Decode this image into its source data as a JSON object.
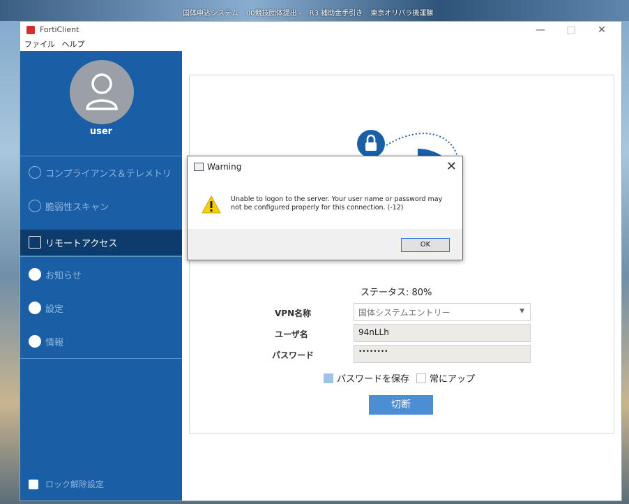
{
  "desktop": {
    "labels": [
      "国体申込システム",
      "00競技団体提出 -",
      "R3 補助金手引き",
      "東京オリパラ機運醸"
    ]
  },
  "window": {
    "title": "FortiClient",
    "menu": [
      "ファイル",
      "ヘルプ"
    ]
  },
  "sidebar": {
    "username": "user",
    "items": [
      {
        "label": "コンプライアンス＆テレメトリ",
        "icon": "gauge-icon"
      },
      {
        "label": "脆弱性スキャン",
        "icon": "vulnerability-icon"
      },
      {
        "label": "リモートアクセス",
        "icon": "remote-access-icon"
      },
      {
        "label": "お知らせ",
        "icon": "notification-icon"
      },
      {
        "label": "設定",
        "icon": "gear-icon"
      },
      {
        "label": "情報",
        "icon": "info-icon"
      }
    ],
    "lock_label": "ロック解除設定"
  },
  "vpn": {
    "status": "ステータス: 80%",
    "name_label": "VPN名称",
    "name_value": "国体システムエントリー",
    "user_label": "ユーザ名",
    "user_value": "94nLLh",
    "password_label": "パスワード",
    "password_value": "••••••••",
    "save_password_label": "パスワードを保存",
    "always_up_label": "常にアップ",
    "disconnect_label": "切断",
    "save_password_checked": true,
    "always_up_checked": false
  },
  "dialog": {
    "title": "Warning",
    "message_line1": "Unable to logon to the server. Your user name or password may",
    "message_line2": "not be configured properly for this connection. (-12)",
    "ok_label": "OK"
  }
}
